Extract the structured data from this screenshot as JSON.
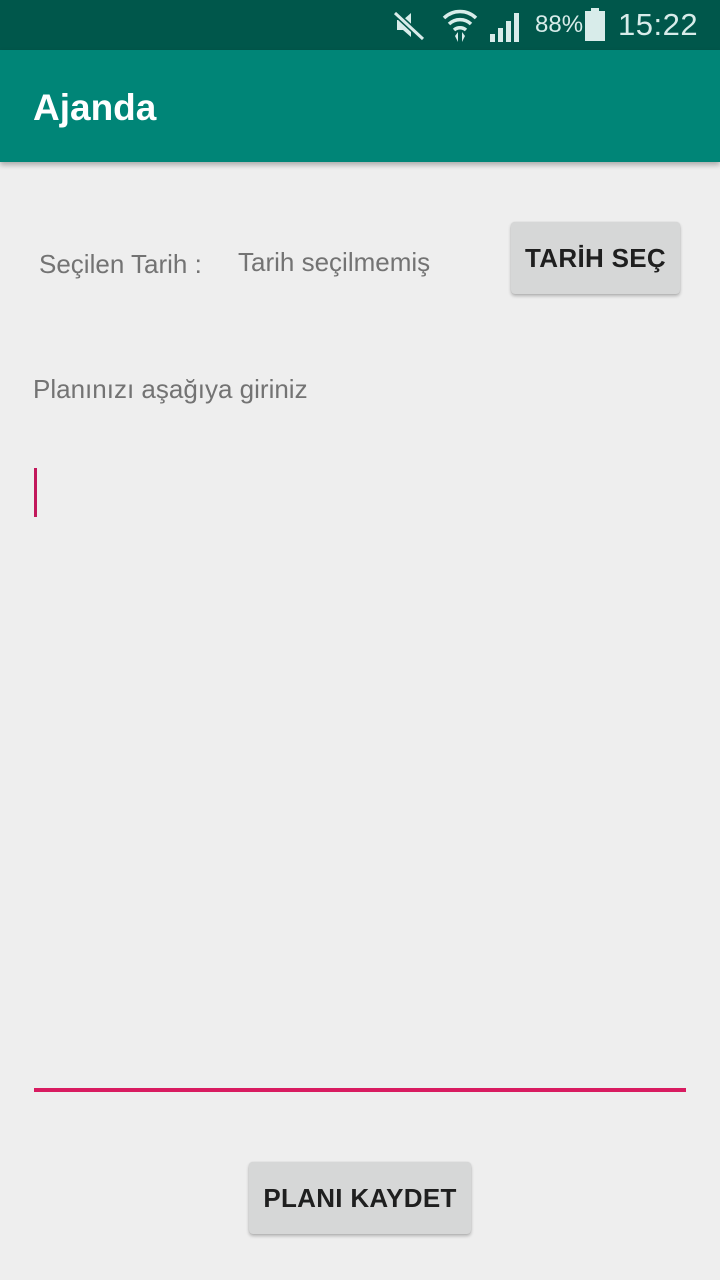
{
  "status_bar": {
    "battery_percent": "88%",
    "time": "15:22",
    "icons": [
      "mute-icon",
      "wifi-icon",
      "signal-icon",
      "battery-icon"
    ]
  },
  "app_bar": {
    "title": "Ajanda"
  },
  "date_row": {
    "label": "Seçilen Tarih :",
    "value": "Tarih seçilmemiş",
    "button_label": "TARİH SEÇ"
  },
  "plan": {
    "prompt": "Planınızı aşağıya giriniz",
    "input_value": ""
  },
  "save_button_label": "PLANI KAYDET",
  "colors": {
    "status_bar": "#00574b",
    "app_bar": "#008577",
    "accent": "#d81b60",
    "background": "#eeeeee",
    "button": "#d6d7d7"
  }
}
